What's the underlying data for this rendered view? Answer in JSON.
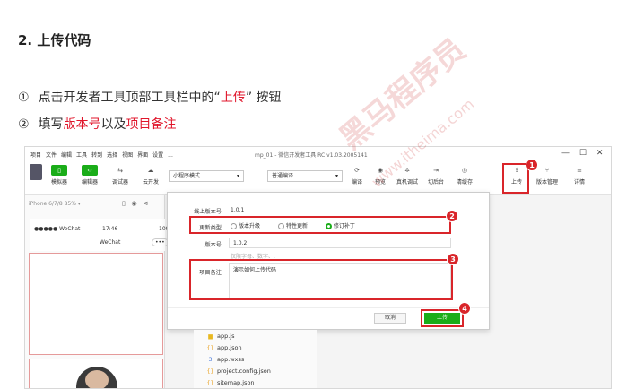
{
  "heading": "2. 上传代码",
  "steps": [
    {
      "num": "①",
      "pre": "点击开发者工具顶部工具栏中的“",
      "hl": "上传",
      "post": "” 按钮"
    },
    {
      "num": "②",
      "pre": "填写",
      "hl": "版本号",
      "mid": "以及",
      "hl2": "项目备注"
    }
  ],
  "app": {
    "menu": [
      "项目",
      "文件",
      "编辑",
      "工具",
      "转到",
      "选择",
      "视图",
      "界面",
      "设置",
      "..."
    ],
    "title": "mp_01 - 微信开发者工具 RC v1.03.2005141",
    "window_controls": [
      "—",
      "☐",
      "✕"
    ],
    "toolbar": {
      "left": [
        {
          "label": "模拟器",
          "icon": "phone-icon",
          "glyph": "▯"
        },
        {
          "label": "编辑器",
          "icon": "code-icon",
          "glyph": "‹›"
        },
        {
          "label": "调试器",
          "icon": "debug-icon",
          "glyph": "⇆"
        },
        {
          "label": "云开发",
          "icon": "cloud-icon",
          "glyph": "☁"
        }
      ],
      "mode_select": "小程序模式",
      "compile_select": "普通编译",
      "middle": [
        {
          "label": "编译",
          "glyph": "⟳"
        },
        {
          "label": "预览",
          "glyph": "◉"
        },
        {
          "label": "真机调试",
          "glyph": "✲"
        },
        {
          "label": "切后台",
          "glyph": "⇥"
        },
        {
          "label": "清缓存",
          "glyph": "◎"
        }
      ],
      "right": [
        {
          "label": "上传",
          "glyph": "⇪"
        },
        {
          "label": "版本管理",
          "glyph": "⑂"
        },
        {
          "label": "详情",
          "glyph": "≡"
        }
      ]
    },
    "simulator": {
      "device": "iPhone 6/7/8 85% ▾",
      "carrier": "●●●●● WeChat",
      "time": "17:46",
      "battery": "100",
      "title": "WeChat",
      "more": "•••"
    },
    "dialog": {
      "online_version_label": "线上版本号",
      "online_version": "1.0.1",
      "update_type_label": "更新类型",
      "options": [
        "版本升级",
        "特性更新",
        "修订补丁"
      ],
      "selected_option": 2,
      "version_label": "版本号",
      "version_value": "1.0.2",
      "version_hint": "仅限字母、数字、.",
      "note_label": "项目备注",
      "note_value": "演示如何上传代码",
      "cancel": "取消",
      "upload": "上传"
    },
    "files": [
      {
        "name": "app.js",
        "glyph": "▆",
        "color": "#e8b820"
      },
      {
        "name": "app.json",
        "glyph": "{}",
        "color": "#e8a020"
      },
      {
        "name": "app.wxss",
        "glyph": "3",
        "color": "#3b6fd8"
      },
      {
        "name": "project.config.json",
        "glyph": "{}",
        "color": "#e8a020"
      },
      {
        "name": "sitemap.json",
        "glyph": "{}",
        "color": "#e8a020"
      }
    ],
    "badges": [
      "1",
      "2",
      "3",
      "4"
    ]
  },
  "watermark": {
    "cn": "黑马程序员",
    "url": "www.itheima.com"
  },
  "colors": {
    "accent_red": "#e0162b",
    "wechat_green": "#1aad19",
    "callout_red": "#d9252a"
  }
}
